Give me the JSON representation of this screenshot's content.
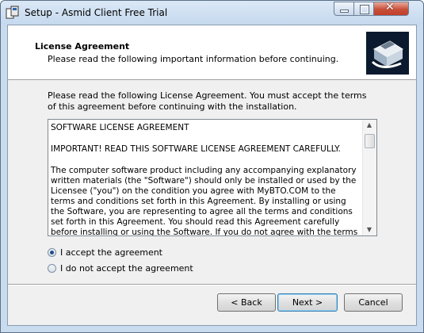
{
  "window": {
    "title": "Setup - Asmid Client Free Trial"
  },
  "header": {
    "title": "License Agreement",
    "subtitle": "Please read the following important information before continuing."
  },
  "intro": "Please read the following License Agreement. You must accept the terms of this agreement before continuing with the installation.",
  "license": {
    "paragraphs": [
      "SOFTWARE LICENSE AGREEMENT",
      "IMPORTANT! READ THIS SOFTWARE LICENSE AGREEMENT CAREFULLY.",
      "The computer software product including any accompanying explanatory written materials (the \"Software\") should only be installed or used by the Licensee (\"you\") on the condition you agree with MyBTO.COM to the terms and conditions set forth in this Agreement.  By installing or using the Software, you are representing to agree all the terms and conditions set forth in this Agreement. You should read this Agreement carefully before installing or using the Software.  If you do not agree with the terms and conditions of this Agreement, you are not permitted to"
    ]
  },
  "options": {
    "accept": "I accept the agreement",
    "decline": "I do not accept the agreement",
    "selected": "accept"
  },
  "buttons": {
    "back": "< Back",
    "next": "Next >",
    "cancel": "Cancel"
  }
}
